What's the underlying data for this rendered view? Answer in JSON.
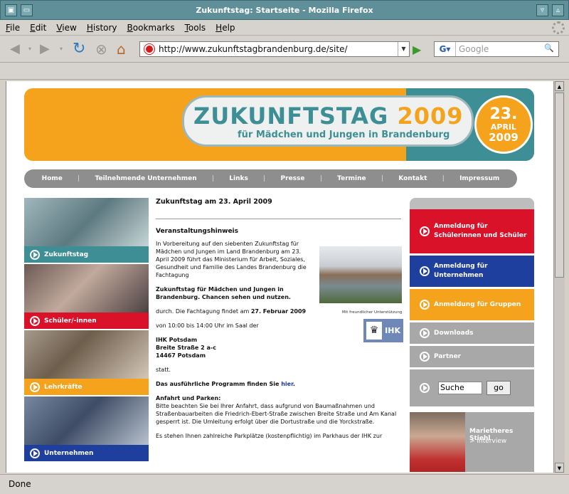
{
  "window": {
    "title": "Zukunftstag: Startseite - Mozilla Firefox"
  },
  "menu": [
    "File",
    "Edit",
    "View",
    "History",
    "Bookmarks",
    "Tools",
    "Help"
  ],
  "toolbar": {
    "url": "http://www.zukunftstagbrandenburg.de/site/",
    "search_placeholder": "Google"
  },
  "banner": {
    "title_main": "ZUKUNFTSTAG",
    "title_year": "2009",
    "subtitle": "für Mädchen und Jungen in Brandenburg",
    "date_day": "23.",
    "date_month": "APRIL",
    "date_year": "2009"
  },
  "nav": [
    "Home",
    "Teilnehmende Unternehmen",
    "Links",
    "Presse",
    "Termine",
    "Kontakt",
    "Impressum"
  ],
  "left_tiles": [
    {
      "label": "Zukunftstag",
      "color": "#3e8f95"
    },
    {
      "label": "Schüler/-innen",
      "color": "#d9122a"
    },
    {
      "label": "Lehrkräfte",
      "color": "#f5a21c"
    },
    {
      "label": "Unternehmen",
      "color": "#1f3f9e"
    }
  ],
  "article": {
    "heading": "Zukunftstag am 23. April 2009",
    "subheading": "Veranstaltungshinweis",
    "intro": "In Vorbereitung auf den siebenten Zukunftstag für Mädchen und Jungen im Land Brandenburg am 23. April 2009 führt das Ministerium für Arbeit, Soziales, Gesundheit und Familie des Landes Brandenburg die Fachtagung",
    "event_title": "Zukunftstag für Mädchen und Jungen in Brandenburg. Chancen sehen und nutzen.",
    "date_prefix": "durch. Die Fachtagung findet am ",
    "date_bold": "27. Februar 2009",
    "time": "von 10:00 bis 14:00 Uhr im Saal der",
    "addr1": "IHK Potsdam",
    "addr2": "Breite Straße 2 a-c",
    "addr3": "14467 Potsdam",
    "statt": "statt.",
    "program_prefix": "Das ausführliche Programm finden Sie ",
    "program_link": "hier",
    "program_suffix": ".",
    "travel_heading": "Anfahrt und Parken:",
    "travel_text": "Bitte beachten Sie bei Ihrer Anfahrt, dass aufgrund von Baumaßnahmen und Straßenbauarbeiten die Friedrich-Ebert-Straße zwischen Breite Straße und Am Kanal gesperrt ist. Die Umleitung erfolgt über die Dortustraße und die Yorckstraße.",
    "parking_text": "Es stehen Ihnen zahlreiche Parkplätze (kostenpflichtig) im Parkhaus der IHK zur",
    "credit": "Mit freundlicher Unterstützung",
    "ihk_logo": "IHK"
  },
  "right_buttons": [
    {
      "label": "Anmeldung für Schülerinnen und Schüler",
      "color": "#d9122a"
    },
    {
      "label": "Anmeldung für Unternehmen",
      "color": "#1f3f9e"
    },
    {
      "label": "Anmeldung für Gruppen",
      "color": "#f5a21c"
    }
  ],
  "right_links": [
    "Downloads",
    "Partner"
  ],
  "site_search": {
    "value": "Suche",
    "button": "go"
  },
  "interview": {
    "name": "Marietheres Stiehl",
    "link": "> Interview"
  },
  "status": "Done"
}
